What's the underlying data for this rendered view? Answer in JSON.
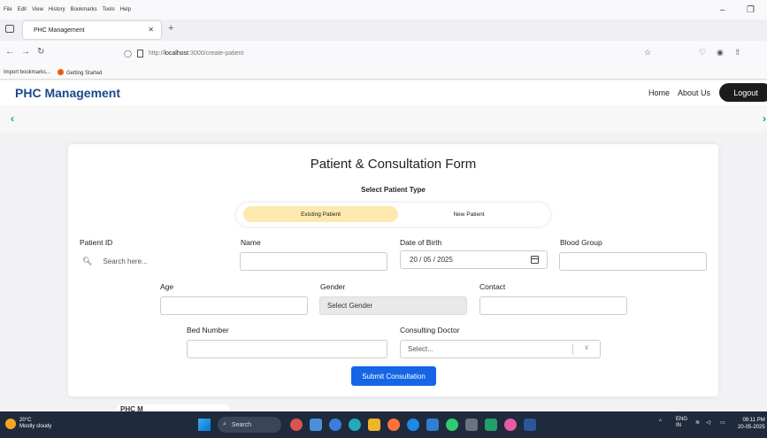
{
  "browser": {
    "menu": [
      "File",
      "Edit",
      "View",
      "History",
      "Bookmarks",
      "Tools",
      "Help"
    ],
    "tab_title": "PHC Management",
    "url_prefix": "http://",
    "url_host": "localhost",
    "url_rest": ":3000/create-patient",
    "bookmarks": [
      "Import bookmarks...",
      "Getting Started"
    ]
  },
  "app": {
    "brand": "PHC Management",
    "nav": {
      "home": "Home",
      "about": "About Us",
      "logout": "Logout"
    },
    "carousel": {
      "prev": "‹",
      "next": "›"
    }
  },
  "form": {
    "title": "Patient & Consultation Form",
    "type_title": "Select Patient Type",
    "types": {
      "existing": "Existing Patient",
      "new": "New Patient"
    },
    "selected_type": "Existing Patient",
    "labels": {
      "patient_id": "Patient ID",
      "name": "Name",
      "dob": "Date of Birth",
      "blood_group": "Blood Group",
      "age": "Age",
      "gender": "Gender",
      "contact": "Contact",
      "bed_number": "Bed Number",
      "consulting_doctor": "Consulting Doctor"
    },
    "values": {
      "search_placeholder": "Search here...",
      "dob": "20 / 05 / 2025",
      "gender": "Select Gender",
      "doctor_placeholder": "Select..."
    },
    "submit": "Submit Consultation"
  },
  "partial_card_text": "PHC M",
  "taskbar": {
    "temperature": "20°C",
    "weather": "Mostly cloudy",
    "search": "Search",
    "lang": "ENG",
    "region": "IN",
    "time": "09:11 PM",
    "date": "20-05-2025"
  },
  "colors": {
    "brand": "#1a4a8a",
    "active_toggle": "#fde8b0",
    "submit": "#1565e6",
    "logout": "#1c1c1c",
    "carousel_arrow": "#1a9a9a"
  }
}
